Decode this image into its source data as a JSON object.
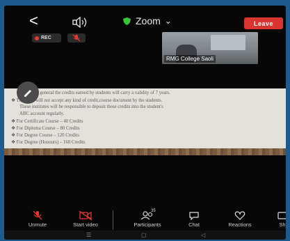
{
  "header": {
    "back_icon": "back-chevron-icon",
    "audio_icon": "speaker-icon",
    "meeting_title": "Zoom",
    "title_caret": "⌄",
    "leave_label": "Leave"
  },
  "status": {
    "rec_label": "REC"
  },
  "participant": {
    "name": "RMG College Saoli"
  },
  "slide": {
    "lines": [
      "In general the credits earned by students will carry a validity of 7 years.",
      "The ABC will not accept any kind of credit,course document by the students.",
      "These institutes will be responsible to deposit these credits into the student's",
      "ABC account regularly.",
      "For Certificate Course – 40 Credits",
      "For Diploma Course – 80 Credits",
      "For Degree Course – 120 Credits",
      "For Degree (Honours) – 160 Credits"
    ]
  },
  "toolbar": {
    "unmute": "Unmute",
    "start_video": "Start video",
    "participants": "Participants",
    "participants_count": "35",
    "chat": "Chat",
    "reactions": "Reactions",
    "share": "Sh"
  },
  "colors": {
    "leave": "#d9342f",
    "record_dot": "#e53935",
    "muted_red": "#e53935",
    "shield_green": "#3cc13b",
    "frame_blue": "#1f5a8c"
  }
}
